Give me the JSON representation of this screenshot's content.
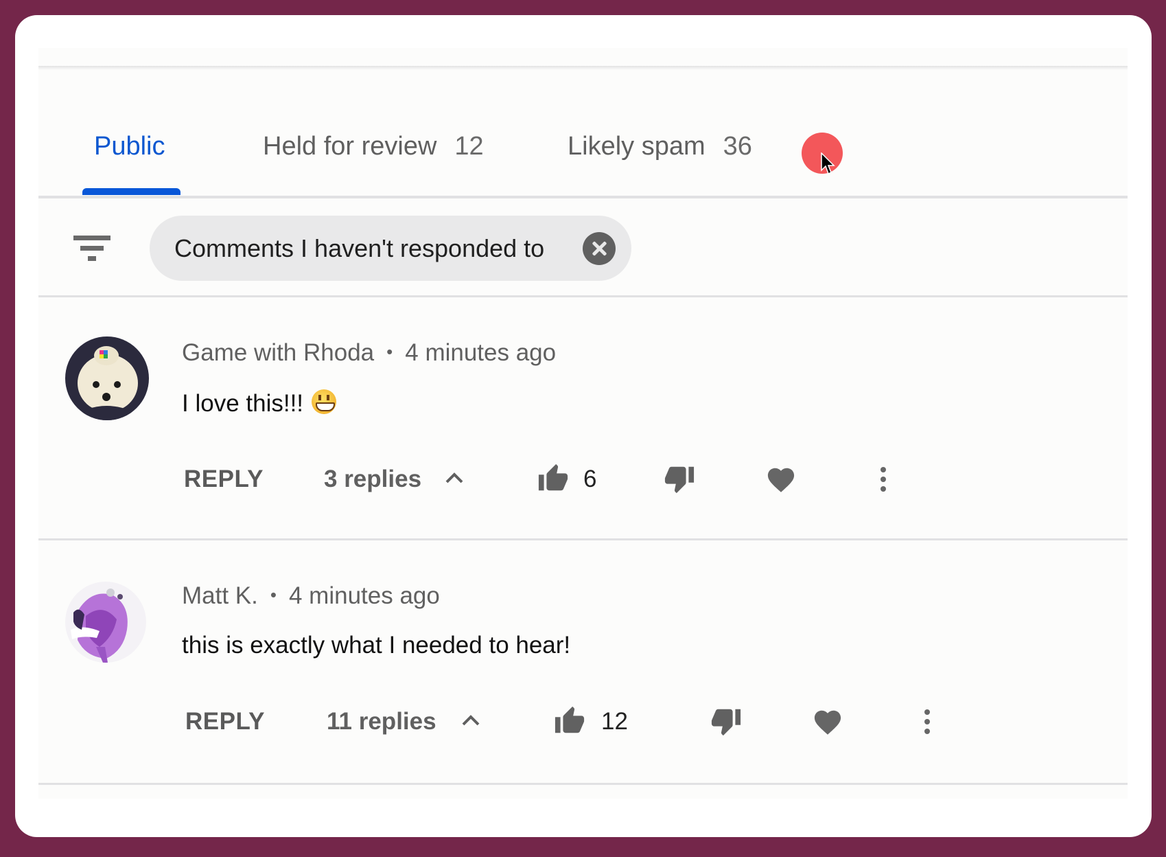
{
  "tabs": [
    {
      "label": "Public",
      "count": "",
      "active": true
    },
    {
      "label": "Held for review",
      "count": "12",
      "active": false
    },
    {
      "label": "Likely spam",
      "count": "36",
      "active": false
    }
  ],
  "filter": {
    "icon": "filter-icon",
    "chip_label": "Comments I haven't responded to",
    "chip_close_icon": "close-circle-icon"
  },
  "comments": [
    {
      "author": "Game with Rhoda",
      "separator": "•",
      "time": "4 minutes ago",
      "text": "I love this!!!",
      "emoji": "grinning-face",
      "reply_label": "REPLY",
      "replies_label": "3 replies",
      "likes": "6",
      "avatar": "white-dog-avatar"
    },
    {
      "author": "Matt K.",
      "separator": "•",
      "time": "4 minutes ago",
      "text": "this is exactly what I needed to hear!",
      "emoji": "",
      "reply_label": "REPLY",
      "replies_label": "11 replies",
      "likes": "12",
      "avatar": "purple-abstract-avatar"
    }
  ],
  "colors": {
    "frame": "#74264a",
    "accent": "#0b57d0",
    "cursor_highlight": "#f3575a"
  }
}
